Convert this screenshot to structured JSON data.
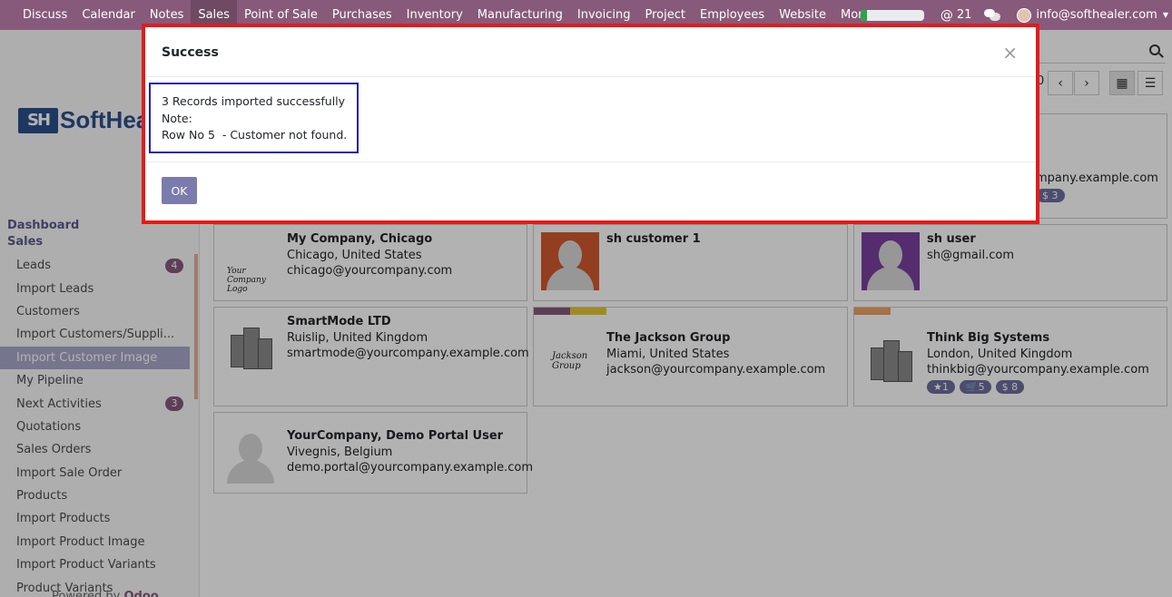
{
  "navbar": {
    "items": [
      {
        "label": "Discuss"
      },
      {
        "label": "Calendar"
      },
      {
        "label": "Notes"
      },
      {
        "label": "Sales",
        "active": true
      },
      {
        "label": "Point of Sale"
      },
      {
        "label": "Purchases"
      },
      {
        "label": "Inventory"
      },
      {
        "label": "Manufacturing"
      },
      {
        "label": "Invoicing"
      },
      {
        "label": "Project"
      },
      {
        "label": "Employees"
      },
      {
        "label": "Website"
      }
    ],
    "more_label": "More",
    "mentions_count": "21",
    "user_email": "info@softhealer.com",
    "accent_color": "#875a7b"
  },
  "sidebar": {
    "brand_mark": "SH",
    "brand_text": "SoftHea",
    "section_dashboard": "Dashboard",
    "section_sales": "Sales",
    "items": [
      {
        "label": "Leads",
        "badge": "4"
      },
      {
        "label": "Import Leads"
      },
      {
        "label": "Customers"
      },
      {
        "label": "Import Customers/Suppli..."
      },
      {
        "label": "Import Customer Image",
        "active": true
      },
      {
        "label": "My Pipeline"
      },
      {
        "label": "Next Activities",
        "badge": "3"
      },
      {
        "label": "Quotations"
      },
      {
        "label": "Sales Orders"
      },
      {
        "label": "Import Sale Order"
      },
      {
        "label": "Products"
      },
      {
        "label": "Import Products"
      },
      {
        "label": "Import Product Image"
      },
      {
        "label": "Import Product Variants"
      },
      {
        "label": "Product Variants"
      }
    ],
    "powered_prefix": "Powered by ",
    "powered_brand": "Odoo"
  },
  "control_panel": {
    "pager_fragment": "0"
  },
  "cards": [
    {
      "name": "",
      "line1": "",
      "email": "mpany.example.com",
      "tags": [
        "$ 3"
      ]
    },
    {
      "name": "My Company, Chicago",
      "line1": "Chicago, United States",
      "email": "chicago@yourcompany.com",
      "logo_text": "Your Company Logo"
    },
    {
      "name": "sh customer 1",
      "line1": "",
      "email": ""
    },
    {
      "name": "sh user",
      "line1": "sh@gmail.com",
      "email": ""
    },
    {
      "name": "SmartMode LTD",
      "line1": "Ruislip, United Kingdom",
      "email": "smartmode@yourcompany.example.com"
    },
    {
      "name": "The Jackson Group",
      "line1": "Miami, United States",
      "email": "jackson@yourcompany.example.com",
      "logo_text": "Jackson Group"
    },
    {
      "name": "Think Big Systems",
      "line1": "London, United Kingdom",
      "email": "thinkbig@yourcompany.example.com",
      "tags": [
        "1",
        "5",
        "$ 8"
      ]
    },
    {
      "name": "YourCompany, Demo Portal User",
      "line1": "Vivegnis, Belgium",
      "email": "demo.portal@yourcompany.example.com"
    }
  ],
  "modal": {
    "title": "Success",
    "close_glyph": "×",
    "lines": [
      "3 Records imported successfully",
      "Note:",
      "Row No 5  - Customer not found."
    ],
    "ok_label": "OK"
  }
}
